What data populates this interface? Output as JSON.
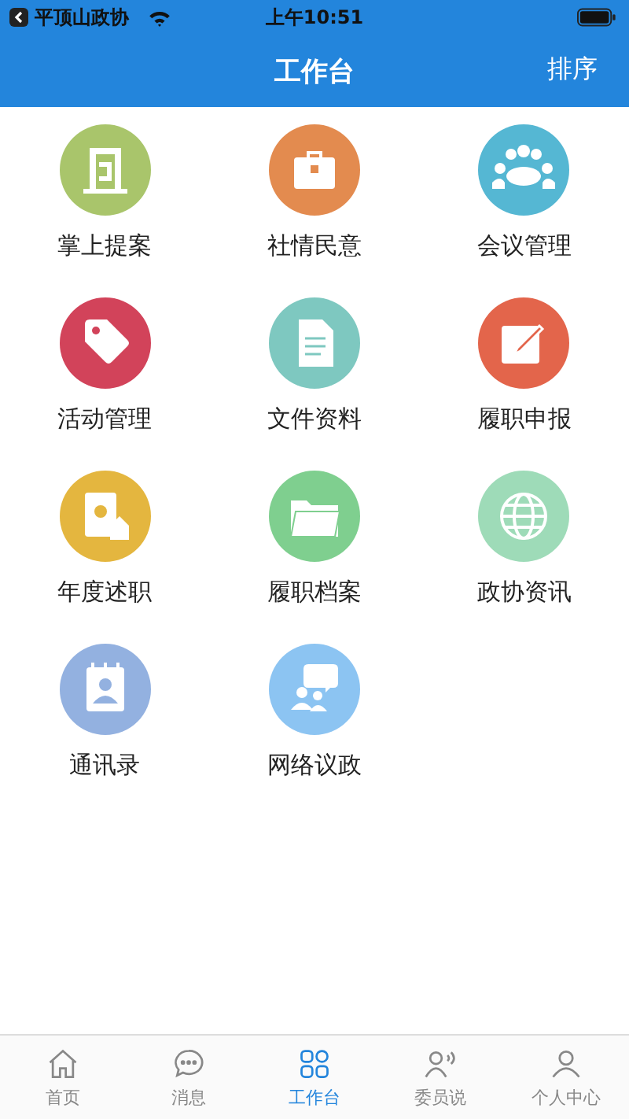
{
  "status_bar": {
    "back_app": "平顶山政协",
    "time": "上午10:51"
  },
  "nav": {
    "title": "工作台",
    "action": "排序"
  },
  "items": [
    {
      "label": "掌上提案",
      "kind": "door",
      "color": "#a9c56b"
    },
    {
      "label": "社情民意",
      "kind": "briefcase",
      "color": "#e38b4f"
    },
    {
      "label": "会议管理",
      "kind": "people",
      "color": "#55b7d3"
    },
    {
      "label": "活动管理",
      "kind": "tag",
      "color": "#d2435a"
    },
    {
      "label": "文件资料",
      "kind": "document",
      "color": "#7ec8c0"
    },
    {
      "label": "履职申报",
      "kind": "pencil",
      "color": "#e3654b"
    },
    {
      "label": "年度述职",
      "kind": "photo",
      "color": "#e4b63f"
    },
    {
      "label": "履职档案",
      "kind": "folder",
      "color": "#7fcf8f"
    },
    {
      "label": "政协资讯",
      "kind": "globe",
      "color": "#9edbb8"
    },
    {
      "label": "通讯录",
      "kind": "contact",
      "color": "#93b1e0"
    },
    {
      "label": "网络议政",
      "kind": "chat",
      "color": "#8cc4f2"
    }
  ],
  "tabs": [
    {
      "label": "首页",
      "kind": "home",
      "selected": false
    },
    {
      "label": "消息",
      "kind": "message",
      "selected": false
    },
    {
      "label": "工作台",
      "kind": "grid",
      "selected": true
    },
    {
      "label": "委员说",
      "kind": "speak",
      "selected": false
    },
    {
      "label": "个人中心",
      "kind": "person",
      "selected": false
    }
  ]
}
